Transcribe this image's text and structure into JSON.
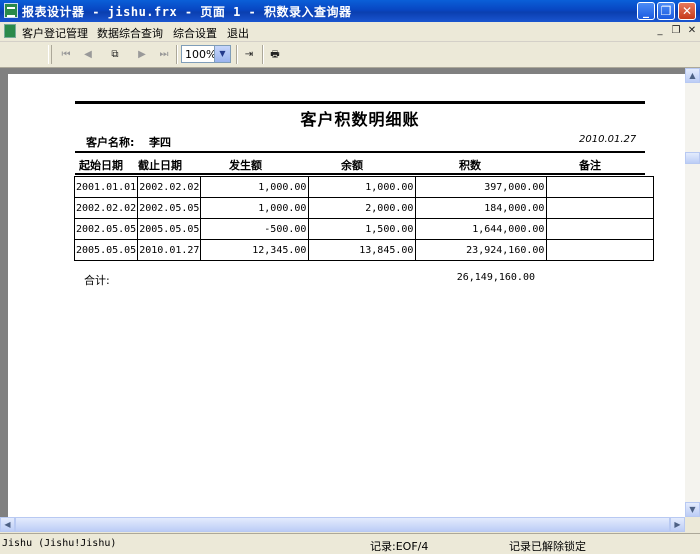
{
  "window": {
    "title": "报表设计器 - jishu.frx - 页面 1 - 积数录入查询器",
    "minimize": "_",
    "maximize": "❐",
    "close": "✕"
  },
  "menu": {
    "items": [
      "客户登记管理",
      "数据综合查询",
      "综合设置",
      "退出"
    ],
    "mdi_minimize": "_",
    "mdi_restore": "❐",
    "mdi_close": "✕"
  },
  "toolbar": {
    "zoom_value": "100%",
    "first_page": "⏮",
    "prev_page": "◀",
    "next_page": "▶",
    "last_page": "⏭",
    "copy_glyph": "⧉",
    "export_glyph": "⇥",
    "print_glyph": "🖶"
  },
  "report": {
    "title": "客户积数明细账",
    "customer_label": "客户名称:",
    "customer_name": "李四",
    "date": "2010.01.27",
    "headers": [
      "起始日期",
      "截止日期",
      "发生额",
      "余额",
      "积数",
      "备注"
    ],
    "rows": [
      [
        "2001.01.01",
        "2002.02.02",
        "1,000.00",
        "1,000.00",
        "397,000.00",
        ""
      ],
      [
        "2002.02.02",
        "2002.05.05",
        "1,000.00",
        "2,000.00",
        "184,000.00",
        ""
      ],
      [
        "2002.05.05",
        "2005.05.05",
        "-500.00",
        "1,500.00",
        "1,644,000.00",
        ""
      ],
      [
        "2005.05.05",
        "2010.01.27",
        "12,345.00",
        "13,845.00",
        "23,924,160.00",
        ""
      ]
    ],
    "total_label": "合计:",
    "total_value": "26,149,160.00"
  },
  "status": {
    "user": "Jishu (Jishu!Jishu)",
    "record": "记录:EOF/4",
    "lock": "记录已解除锁定"
  },
  "colors": {
    "titlebar": "#0a4fd0",
    "desktop_gray": "#808080",
    "chrome": "#ece9d8"
  }
}
